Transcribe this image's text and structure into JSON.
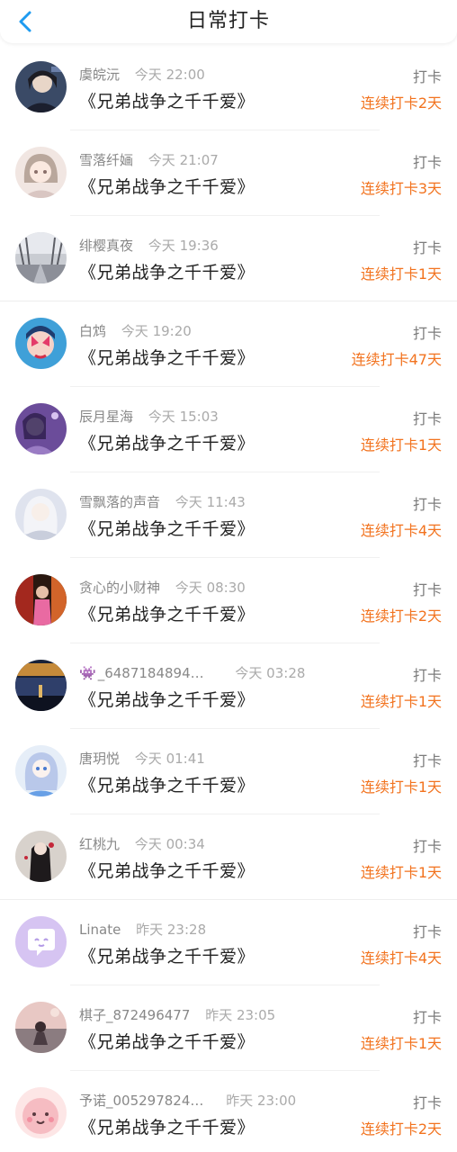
{
  "header": {
    "title": "日常打卡",
    "back_icon": "chevron-left-icon"
  },
  "entries": [
    {
      "name": "虞皖沅",
      "time": "今天 22:00",
      "book": "《兄弟战争之千千爱》",
      "action": "打卡",
      "streak": "连续打卡2天",
      "emoji": ""
    },
    {
      "name": "雪落纤婳",
      "time": "今天 21:07",
      "book": "《兄弟战争之千千爱》",
      "action": "打卡",
      "streak": "连续打卡3天",
      "emoji": ""
    },
    {
      "name": "绯樱真夜",
      "time": "今天 19:36",
      "book": "《兄弟战争之千千爱》",
      "action": "打卡",
      "streak": "连续打卡1天",
      "emoji": ""
    },
    {
      "name": "白鸩",
      "time": "今天 19:20",
      "book": "《兄弟战争之千千爱》",
      "action": "打卡",
      "streak": "连续打卡47天",
      "emoji": ""
    },
    {
      "name": "辰月星海",
      "time": "今天 15:03",
      "book": "《兄弟战争之千千爱》",
      "action": "打卡",
      "streak": "连续打卡1天",
      "emoji": ""
    },
    {
      "name": "雪飘落的声音",
      "time": "今天 11:43",
      "book": "《兄弟战争之千千爱》",
      "action": "打卡",
      "streak": "连续打卡4天",
      "emoji": ""
    },
    {
      "name": "贪心的小财神",
      "time": "今天 08:30",
      "book": "《兄弟战争之千千爱》",
      "action": "打卡",
      "streak": "连续打卡2天",
      "emoji": ""
    },
    {
      "name": "_6487184894…",
      "time": "今天 03:28",
      "book": "《兄弟战争之千千爱》",
      "action": "打卡",
      "streak": "连续打卡1天",
      "emoji": "👾"
    },
    {
      "name": "唐玥悦",
      "time": "今天 01:41",
      "book": "《兄弟战争之千千爱》",
      "action": "打卡",
      "streak": "连续打卡1天",
      "emoji": ""
    },
    {
      "name": "红桃九",
      "time": "今天 00:34",
      "book": "《兄弟战争之千千爱》",
      "action": "打卡",
      "streak": "连续打卡1天",
      "emoji": ""
    },
    {
      "name": "Linate",
      "time": "昨天 23:28",
      "book": "《兄弟战争之千千爱》",
      "action": "打卡",
      "streak": "连续打卡4天",
      "emoji": ""
    },
    {
      "name": "棋子_872496477",
      "time": "昨天 23:05",
      "book": "《兄弟战争之千千爱》",
      "action": "打卡",
      "streak": "连续打卡1天",
      "emoji": ""
    },
    {
      "name": "予诺_005297824…",
      "time": "昨天 23:00",
      "book": "《兄弟战争之千千爱》",
      "action": "打卡",
      "streak": "连续打卡2天",
      "emoji": ""
    }
  ],
  "colors": {
    "accent": "#f2731f",
    "back": "#1e9bf0"
  }
}
